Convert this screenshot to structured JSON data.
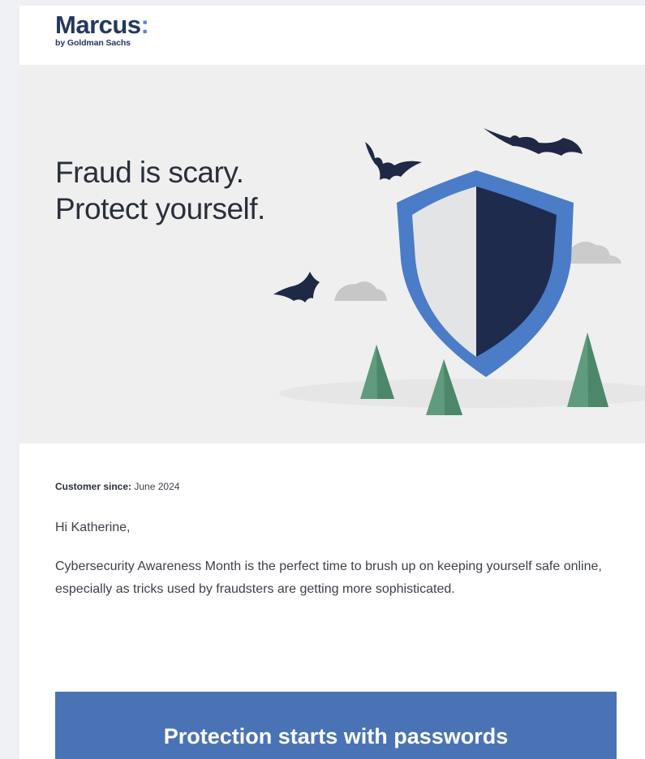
{
  "logo": {
    "word": "Marcus",
    "colon": ":",
    "sub": "by Goldman Sachs"
  },
  "hero": {
    "line1": "Fraud is scary.",
    "line2": "Protect yourself.",
    "illustration": [
      "bat-icon",
      "shield-icon",
      "cloud-icon",
      "tree-icon"
    ]
  },
  "customer": {
    "label": "Customer since:",
    "value": " June 2024"
  },
  "greeting": "Hi Katherine,",
  "intro": "Cybersecurity Awareness Month is the perfect time to brush up on keeping yourself safe online, especially as tricks used by fraudsters are getting more sophisticated.",
  "banner": {
    "title": "Protection starts with passwords"
  },
  "colors": {
    "brand_navy": "#25375f",
    "brand_blue": "#4a73b5",
    "hero_bg": "#efefef"
  }
}
